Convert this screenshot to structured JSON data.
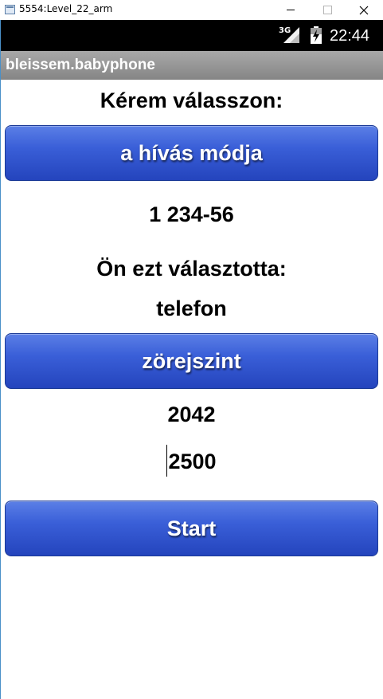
{
  "window": {
    "title": "5554:Level_22_arm",
    "app_icon": "emulator-window-icon",
    "minimize_icon": "minimize-icon",
    "maximize_icon": "maximize-icon",
    "close_icon": "close-icon"
  },
  "statusbar": {
    "network": "3G",
    "signal_icon": "signal-icon",
    "battery_icon": "battery-charging-icon",
    "time": "22:44"
  },
  "actionbar": {
    "title": "bleissem.babyphone"
  },
  "main": {
    "prompt": "Kérem válasszon:",
    "call_mode_button": "a hívás módja",
    "phone_number": "1 234-56",
    "selected_label": "Ön ezt választotta:",
    "selected_value": "telefon",
    "noise_level_button": "zörejszint",
    "current_noise": "2042",
    "noise_threshold": "2500",
    "start_button": "Start"
  },
  "colors": {
    "button_top": "#5b7fe6",
    "button_bottom": "#2444bd",
    "actionbar": "#9a9a9a",
    "statusbar": "#000000"
  }
}
